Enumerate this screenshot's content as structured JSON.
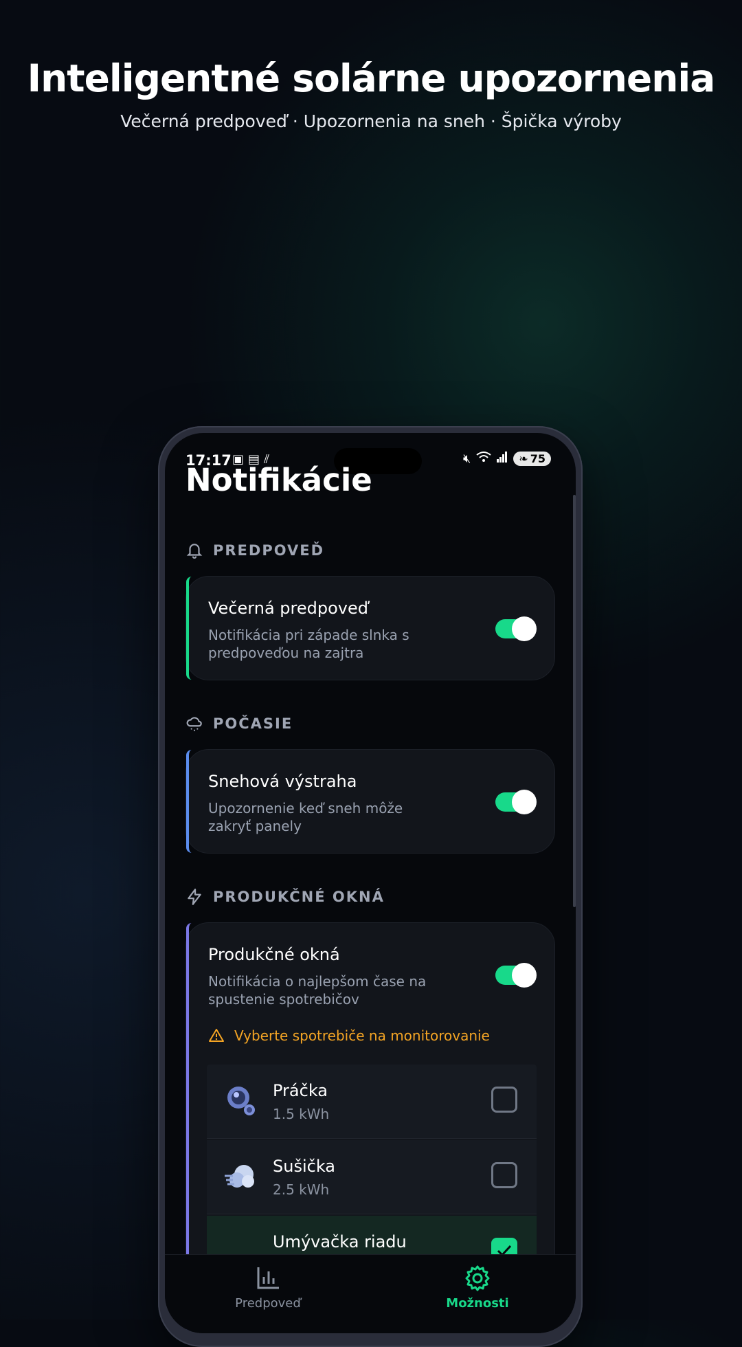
{
  "hero": {
    "title": "Inteligentné solárne upozornenia",
    "subtitle": "Večerná predpoveď · Upozornenia na sneh · Špička výroby"
  },
  "status_bar": {
    "time": "17:17",
    "battery": "75"
  },
  "page_title": "Notifikácie",
  "sections": [
    {
      "header": "PREDPOVEĎ",
      "icon": "bell-icon",
      "card": {
        "title": "Večerná predpoveď",
        "description": "Notifikácia pri západe slnka s predpoveďou na zajtra",
        "enabled": true,
        "accent": "#18d98a"
      }
    },
    {
      "header": "POČASIE",
      "icon": "snow-cloud-icon",
      "card": {
        "title": "Snehová výstraha",
        "description": "Upozornenie keď sneh môže zakryť panely",
        "enabled": true,
        "accent": "#5b8def"
      }
    },
    {
      "header": "PRODUKČNÉ OKNÁ",
      "icon": "lightning-icon",
      "card": {
        "title": "Produkčné okná",
        "description": "Notifikácia o najlepšom čase na spustenie spotrebičov",
        "enabled": true,
        "accent": "#7b78e6",
        "warning": "Vyberte spotrebiče na monitorovanie",
        "appliances": [
          {
            "name": "Práčka",
            "energy": "1.5 kWh",
            "checked": false,
            "icon": "washing-machine-icon"
          },
          {
            "name": "Sušička",
            "energy": "2.5 kWh",
            "checked": false,
            "icon": "dryer-icon"
          },
          {
            "name": "Umývačka riadu",
            "energy": "",
            "checked": true,
            "icon": "dishwasher-icon"
          }
        ]
      }
    }
  ],
  "tabs": [
    {
      "label": "Predpoveď",
      "icon": "bar-chart-icon",
      "active": false
    },
    {
      "label": "Možnosti",
      "icon": "gear-icon",
      "active": true
    }
  ],
  "colors": {
    "accent_green": "#18d98a",
    "warning_orange": "#f5a524",
    "inactive_tab": "#8a92a0"
  }
}
